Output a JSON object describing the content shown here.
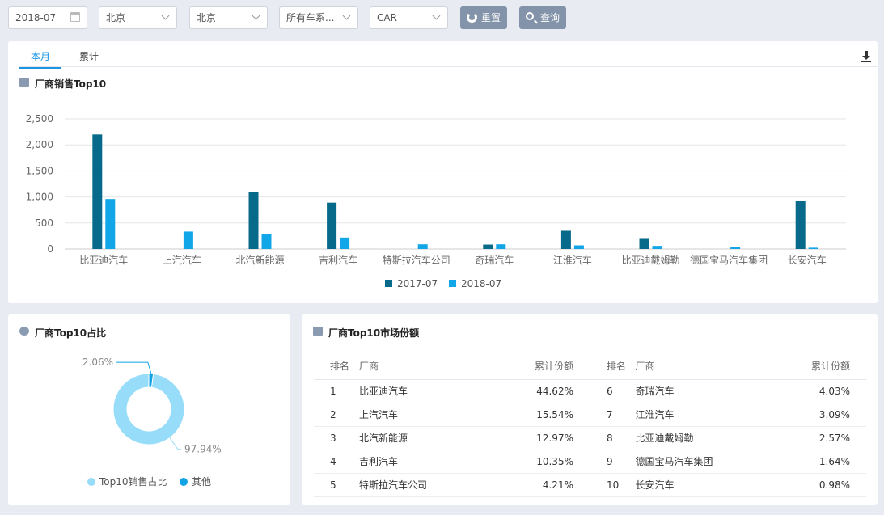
{
  "filters": {
    "date": "2018-07",
    "province": "北京",
    "city": "北京",
    "series": "所有车系...",
    "type": "CAR",
    "reset_label": "重置",
    "query_label": "查询"
  },
  "tabs": [
    "本月",
    "累计"
  ],
  "colors": {
    "series2017": "#086a8a",
    "series2018": "#10a6e8",
    "accent": "#1a94e3",
    "pie_top10": "#97dcf8",
    "pie_other": "#12a3e4"
  },
  "bar_panel": {
    "title": "厂商销售Top10"
  },
  "chart_data": [
    {
      "type": "bar",
      "title": "厂商销售Top10",
      "categories": [
        "比亚迪汽车",
        "上汽汽车",
        "北汽新能源",
        "吉利汽车",
        "特斯拉汽车公司",
        "奇瑞汽车",
        "江淮汽车",
        "比亚迪戴姆勒",
        "德国宝马汽车集团",
        "长安汽车"
      ],
      "series": [
        {
          "name": "2017-07",
          "values": [
            2200,
            0,
            1090,
            890,
            0,
            85,
            350,
            210,
            0,
            920
          ]
        },
        {
          "name": "2018-07",
          "values": [
            960,
            335,
            280,
            220,
            90,
            90,
            70,
            60,
            40,
            25
          ]
        }
      ],
      "yticks": [
        "0",
        "500",
        "1,000",
        "1,500",
        "2,000",
        "2,500"
      ],
      "ylim": [
        0,
        2500
      ],
      "grid": true,
      "legend": "bottom-center"
    },
    {
      "type": "pie",
      "title": "厂商Top10占比",
      "slices": [
        {
          "name": "Top10销售占比",
          "value": 97.94,
          "label": "97.94%"
        },
        {
          "name": "其他",
          "value": 2.06,
          "label": "2.06%"
        }
      ],
      "legend": "bottom-center"
    }
  ],
  "pie_panel": {
    "title": "厂商Top10占比"
  },
  "table_panel": {
    "title": "厂商Top10市场份额",
    "headers": [
      "排名",
      "厂商",
      "累计份额",
      "排名",
      "厂商",
      "累计份额"
    ],
    "rows": [
      [
        "1",
        "比亚迪汽车",
        "44.62%",
        "6",
        "奇瑞汽车",
        "4.03%"
      ],
      [
        "2",
        "上汽汽车",
        "15.54%",
        "7",
        "江淮汽车",
        "3.09%"
      ],
      [
        "3",
        "北汽新能源",
        "12.97%",
        "8",
        "比亚迪戴姆勒",
        "2.57%"
      ],
      [
        "4",
        "吉利汽车",
        "10.35%",
        "9",
        "德国宝马汽车集团",
        "1.64%"
      ],
      [
        "5",
        "特斯拉汽车公司",
        "4.21%",
        "10",
        "长安汽车",
        "0.98%"
      ]
    ]
  }
}
